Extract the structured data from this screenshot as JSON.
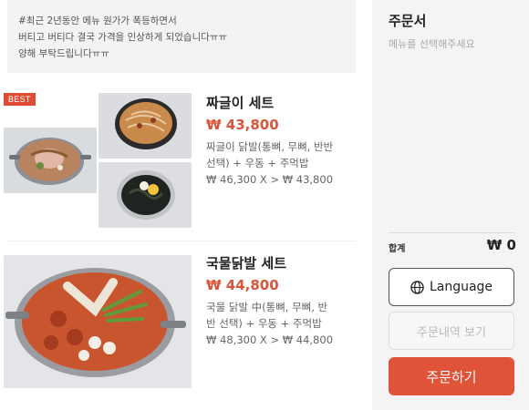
{
  "notice": {
    "lines": [
      "#최근 2년동안 메뉴 원가가 폭등하면서",
      "버티고 버티다 결국 가격을 인상하게 되었습니다ㅠㅠ",
      "양해 부탁드립니다ㅠㅠ"
    ]
  },
  "menu": [
    {
      "badge": "BEST",
      "name": "짜글이 세트",
      "price": "₩ 43,800",
      "desc": [
        "짜글이 닭발(통뼈, 무뼈, 반반",
        "선택) + 우동 + 주먹밥",
        "₩ 46,300 X > ₩ 43,800"
      ]
    },
    {
      "badge": "",
      "name": "국물닭발 세트",
      "price": "₩ 44,800",
      "desc": [
        "국물 닭발 中(통뼈, 무뼈, 반",
        "반 선택) + 우동 + 주먹밥",
        "₩ 48,300 X > ₩ 44,800"
      ]
    }
  ],
  "order": {
    "title": "주문서",
    "hint": "메뉴를 선택해주세요",
    "total_label": "합계",
    "total_value": "₩ 0",
    "language_label": "Language",
    "history_label": "주문내역 보기",
    "order_label": "주문하기"
  },
  "colors": {
    "accent": "#df5438",
    "badge": "#e04b35"
  }
}
